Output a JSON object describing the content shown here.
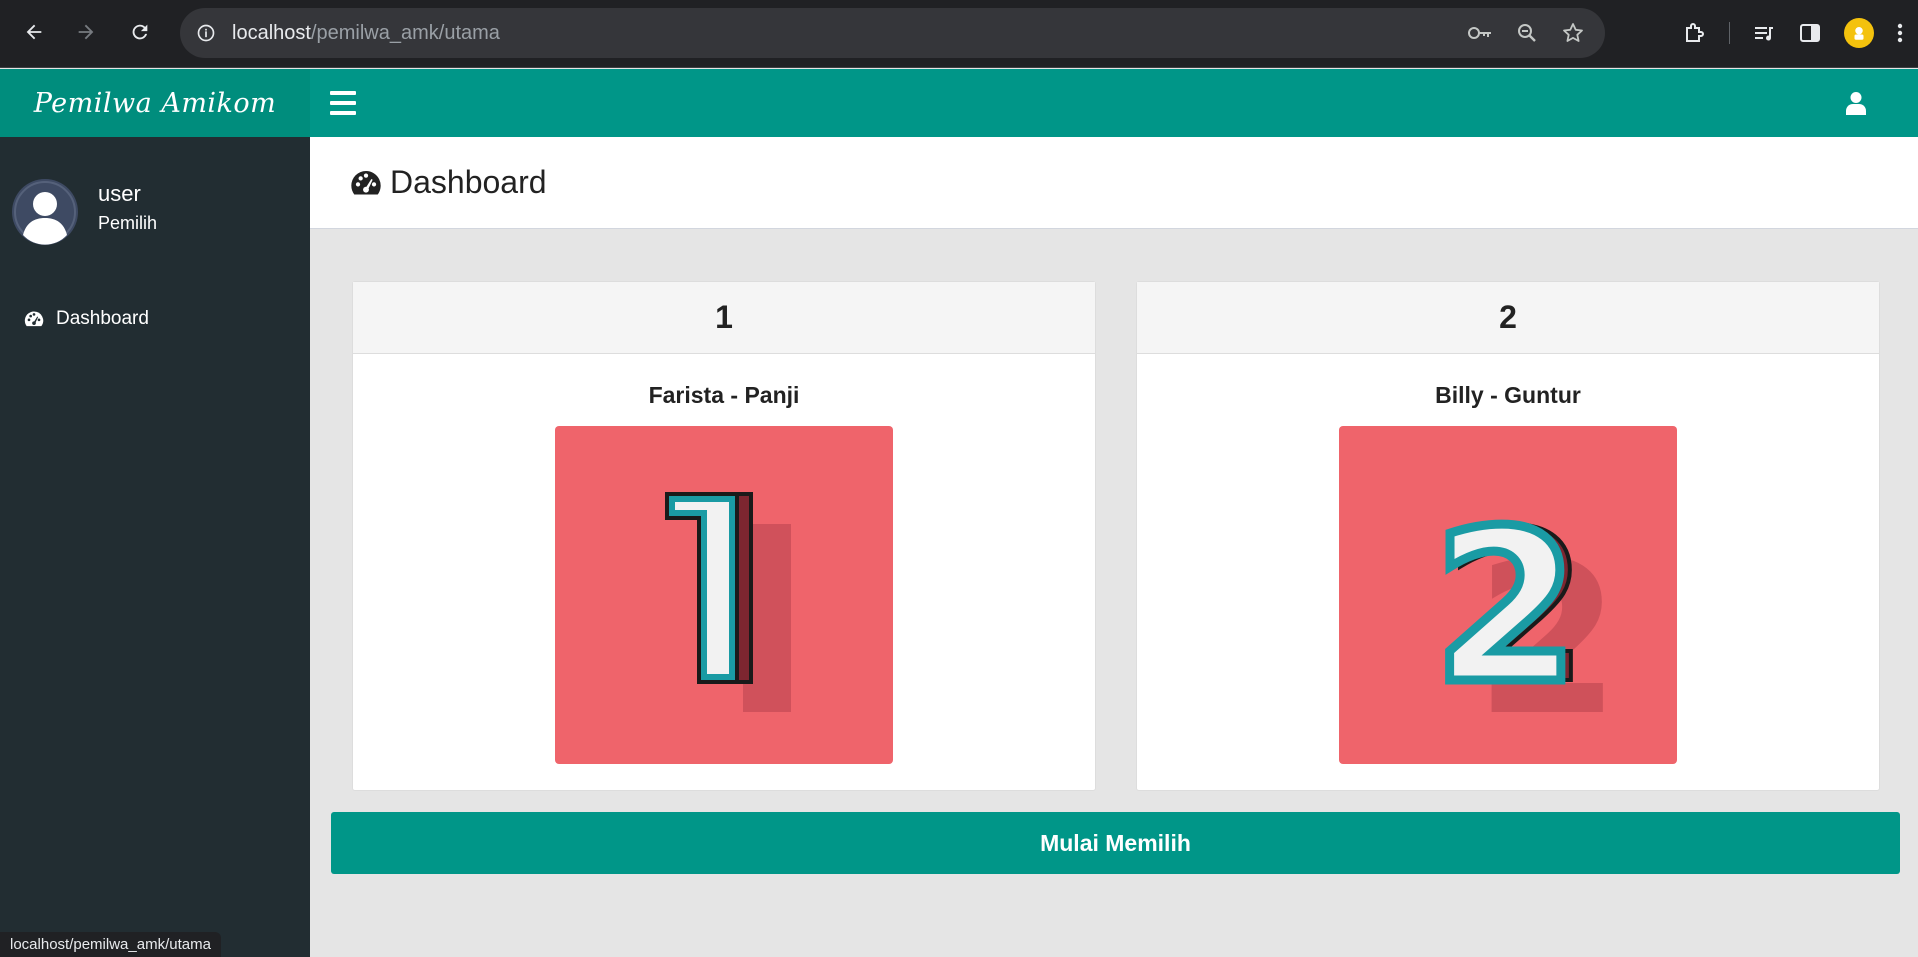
{
  "browser": {
    "url_host": "localhost",
    "url_path": "/pemilwa_amk/utama",
    "status_url": "localhost/pemilwa_amk/utama"
  },
  "app": {
    "brand": "Pemilwa Amikom",
    "theme_color": "#009688",
    "sidebar_color": "#222d32"
  },
  "user": {
    "name": "user",
    "role": "Pemilih"
  },
  "sidebar": {
    "items": [
      {
        "label": "Dashboard",
        "icon": "dashboard-icon"
      }
    ]
  },
  "page": {
    "title": "Dashboard"
  },
  "candidates": [
    {
      "number": "1",
      "name": "Farista - Panji",
      "image_color": "#ef646b"
    },
    {
      "number": "2",
      "name": "Billy - Guntur",
      "image_color": "#ef646b"
    }
  ],
  "actions": {
    "vote_label": "Mulai Memilih"
  }
}
